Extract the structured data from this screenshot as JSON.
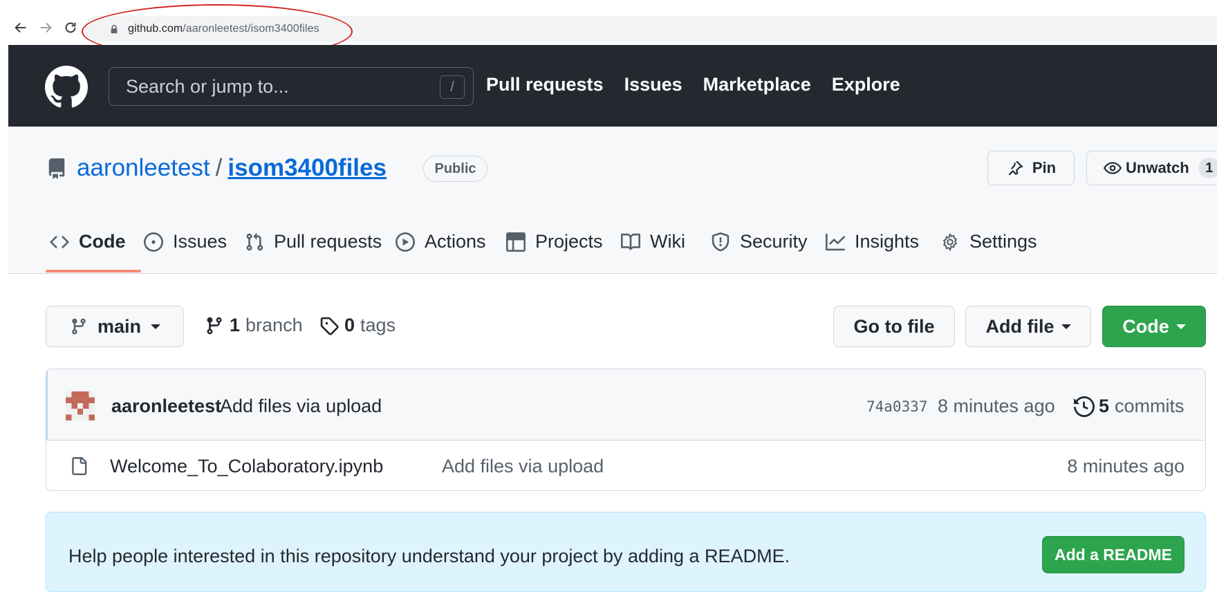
{
  "browser": {
    "url_domain": "github.com",
    "url_path": "/aaronleetest/isom3400files",
    "annotation_color": "#d32020"
  },
  "header": {
    "search_placeholder": "Search or jump to...",
    "search_shortcut": "/",
    "nav": [
      "Pull requests",
      "Issues",
      "Marketplace",
      "Explore"
    ]
  },
  "repo": {
    "owner": "aaronleetest",
    "separator": "/",
    "name": "isom3400files",
    "visibility": "Public",
    "pin_label": "Pin",
    "watch_label": "Unwatch",
    "watch_count": "1"
  },
  "tabs": [
    {
      "label": "Code",
      "icon": "code-icon",
      "active": true
    },
    {
      "label": "Issues",
      "icon": "issue-opened-icon"
    },
    {
      "label": "Pull requests",
      "icon": "git-pull-request-icon"
    },
    {
      "label": "Actions",
      "icon": "play-icon"
    },
    {
      "label": "Projects",
      "icon": "table-icon"
    },
    {
      "label": "Wiki",
      "icon": "book-icon"
    },
    {
      "label": "Security",
      "icon": "shield-icon"
    },
    {
      "label": "Insights",
      "icon": "graph-icon"
    },
    {
      "label": "Settings",
      "icon": "gear-icon"
    }
  ],
  "toolbar": {
    "branch": "main",
    "branch_count": "1",
    "branch_label": "branch",
    "tag_count": "0",
    "tag_label": "tags",
    "goto_label": "Go to file",
    "addfile_label": "Add file",
    "code_label": "Code"
  },
  "commit": {
    "author": "aaronleetest",
    "message": "Add files via upload",
    "sha": "74a0337",
    "time": "8 minutes ago",
    "count": "5",
    "count_label": "commits"
  },
  "files": [
    {
      "name": "Welcome_To_Colaboratory.ipynb",
      "message": "Add files via upload",
      "time": "8 minutes ago"
    }
  ],
  "readme": {
    "text": "Help people interested in this repository understand your project by adding a README.",
    "button": "Add a README"
  },
  "colors": {
    "header_bg": "#24292f",
    "link": "#0969da",
    "primary_green": "#2da44e",
    "tab_underline": "#fd8c73",
    "banner_bg": "#ddf4ff"
  }
}
